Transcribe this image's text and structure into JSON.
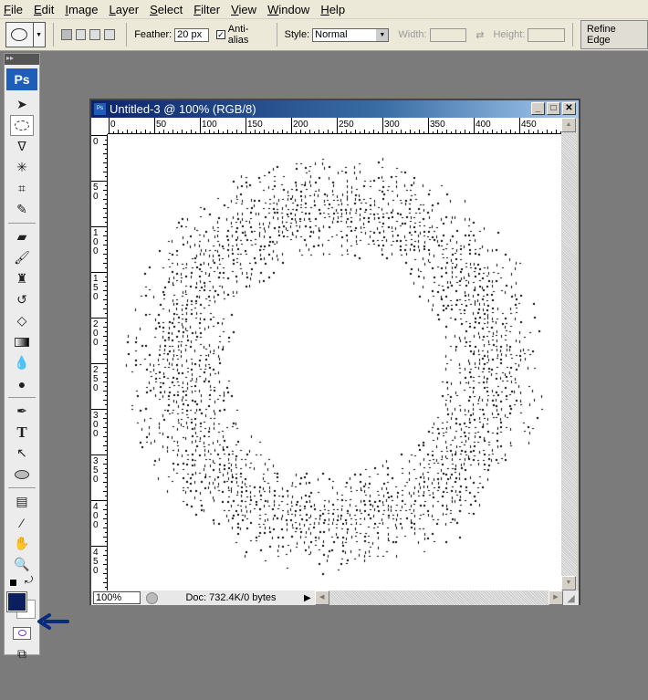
{
  "menu": [
    "File",
    "Edit",
    "Image",
    "Layer",
    "Select",
    "Filter",
    "View",
    "Window",
    "Help"
  ],
  "options": {
    "tool_icon": "elliptical-marquee-icon",
    "feather_label": "Feather:",
    "feather_value": "20 px",
    "antialias_label": "Anti-alias",
    "antialias_checked": true,
    "style_label": "Style:",
    "style_value": "Normal",
    "width_label": "Width:",
    "height_label": "Height:",
    "refine_edge": "Refine Edge"
  },
  "toolbox": {
    "logo": "Ps",
    "tools": [
      "move",
      "elliptical-marquee",
      "lasso",
      "magic-wand",
      "crop",
      "slice",
      "healing-brush",
      "brush",
      "clone-stamp",
      "history-brush",
      "eraser",
      "gradient",
      "blur",
      "dodge",
      "pen",
      "type",
      "path-selection",
      "ellipse-shape",
      "notes",
      "eyedropper",
      "hand",
      "zoom"
    ],
    "foreground_color": "#0a1f5c",
    "background_color": "#ffffff"
  },
  "document": {
    "title": "Untitled-3 @ 100% (RGB/8)",
    "ruler_labels": [
      "0",
      "50",
      "100",
      "150",
      "200",
      "250",
      "300",
      "350",
      "400",
      "450"
    ],
    "zoom": "100%",
    "doc_info": "Doc: 732.4K/0 bytes"
  },
  "annotation_color": "#0a2a7a"
}
